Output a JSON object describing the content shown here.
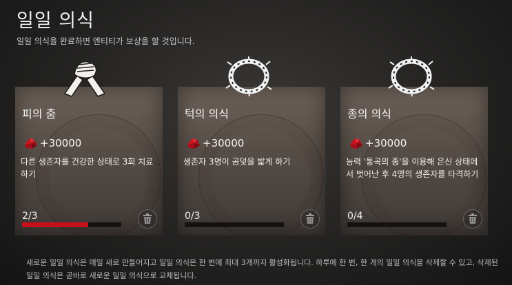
{
  "header": {
    "title": "일일 의식",
    "subtitle": "일일 의식을 완료하면 엔티티가 보상을 할 것입니다."
  },
  "rituals": [
    {
      "name": "피의 춤",
      "emblem": "clasped-hands-icon",
      "reward": "+30000",
      "description": "다른 생존자를 건강한 상태로 3회 치료하기",
      "progress_text": "2/3",
      "progress": 0.6667
    },
    {
      "name": "턱의 의식",
      "emblem": "thorn-wreath-icon",
      "reward": "+30000",
      "description": "생존자 3명이 곰덫을 밟게 하기",
      "progress_text": "0/3",
      "progress": 0
    },
    {
      "name": "종의 의식",
      "emblem": "thorn-wreath-icon",
      "reward": "+30000",
      "description": "능력 '통곡의 종'을 이용해 은신 상태에서 벗어난 후 4명의 생존자를 타격하기",
      "progress_text": "0/4",
      "progress": 0
    }
  ],
  "footer": "새로운 일일 의식은 매일 새로 만들어지고 일일 의식은 한 번에 최대 3개까지 활성화됩니다. 하루에 한 번, 한 개의 일일 의식을 삭제할 수 있고, 삭제된 일일 의식은 곧바로 새로운 일일 의식으로 교체됩니다.",
  "colors": {
    "accent": "#c8101a",
    "gem": "#b3121c"
  }
}
